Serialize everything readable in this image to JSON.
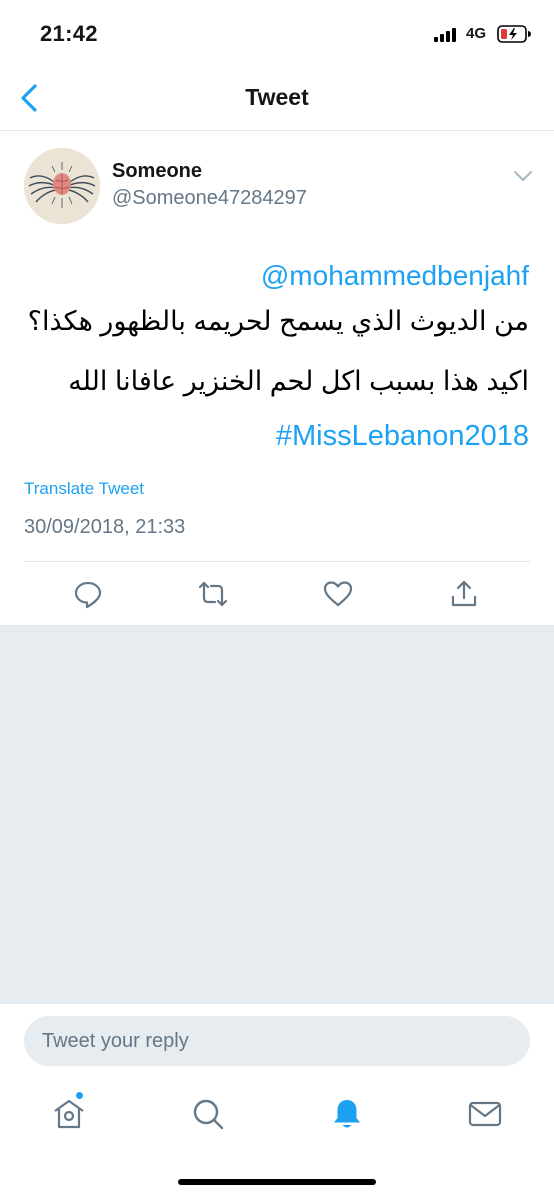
{
  "status_bar": {
    "time": "21:42",
    "network": "4G"
  },
  "nav": {
    "title": "Tweet"
  },
  "tweet": {
    "user_name": "Someone",
    "user_handle": "@Someone47284297",
    "mention": "@mohammedbenjahf",
    "text_line_1": "من الديوث الذي يسمح لحريمه بالظهور هكذا؟",
    "text_line_2": "اكيد هذا بسبب اكل لحم الخنزير عافانا الله",
    "hashtag": "#MissLebanon2018",
    "translate_label": "Translate Tweet",
    "timestamp": "30/09/2018, 21:33"
  },
  "reply": {
    "placeholder": "Tweet your reply"
  },
  "icons": {
    "back": "chevron-left-icon",
    "more": "chevron-down-icon",
    "reply": "reply-icon",
    "retweet": "retweet-icon",
    "like": "heart-icon",
    "share": "share-icon",
    "home": "home-icon",
    "search": "search-icon",
    "notifications": "bell-icon",
    "messages": "mail-icon"
  },
  "colors": {
    "accent": "#1da1f2",
    "secondary_text": "#657786",
    "background_gray": "#e6ecf0",
    "battery_low": "#e0393e"
  }
}
